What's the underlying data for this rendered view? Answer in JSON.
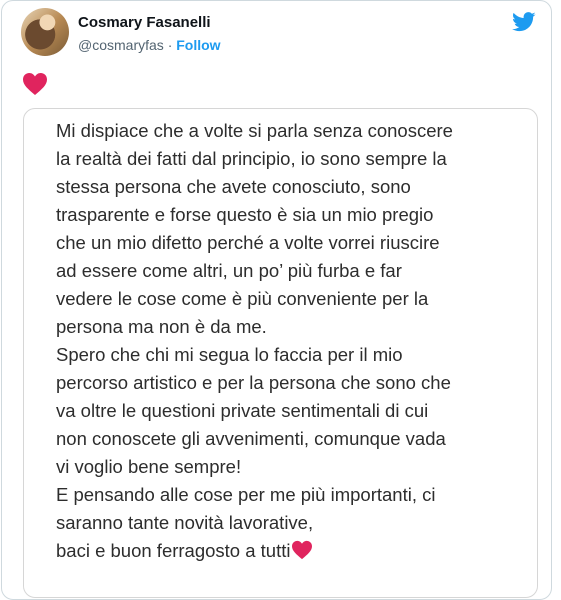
{
  "tweet": {
    "author_name": "Cosmary Fasanelli",
    "handle": "@cosmaryfas",
    "separator": "·",
    "follow_label": "Follow",
    "body_emoji": "red-heart-icon",
    "brand_color": "#1d9bf0",
    "heart_color": "#e0245e"
  },
  "image_text": {
    "lines": [
      "Mi dispiace che a volte si parla senza conoscere",
      "la realtà dei fatti dal principio, io sono sempre la",
      "stessa persona che avete conosciuto, sono",
      "trasparente e forse questo è sia un mio pregio",
      "che un mio difetto perché a volte vorrei riuscire",
      "ad essere come altri, un po’ più furba e far",
      "vedere le cose come è più conveniente per la",
      "persona ma non è da me.",
      "Spero che chi mi segua lo faccia per il mio",
      "percorso artistico e per la persona che sono che",
      "va oltre le questioni private sentimentali di cui",
      "non conoscete gli avvenimenti, comunque vada",
      "vi voglio bene sempre!",
      "E pensando alle cose per me più importanti, ci",
      "saranno tante novità lavorative,",
      "baci e buon ferragosto a tutti"
    ],
    "trailing_emoji": "red-heart-icon"
  }
}
